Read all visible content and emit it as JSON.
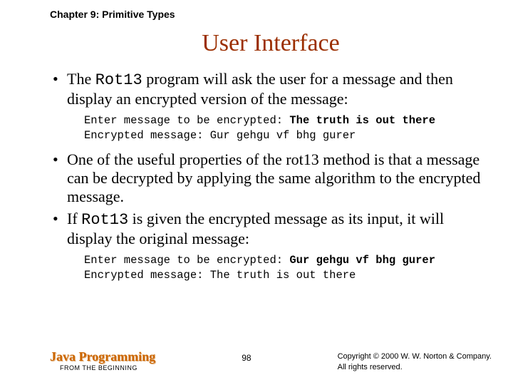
{
  "chapter": "Chapter 9: Primitive Types",
  "title": "User Interface",
  "bullets": {
    "b1_pre": "The ",
    "b1_code": "Rot13",
    "b1_post": " program will ask the user for a message and then display an encrypted version of the message:",
    "code1_line1_label": "Enter message to be encrypted: ",
    "code1_line1_input": "The truth is out there",
    "code1_line2": "Encrypted message: Gur gehgu vf bhg gurer",
    "b2": "One of the useful properties of the rot13 method is that a message can be decrypted by applying the same algorithm to the encrypted message.",
    "b3_pre": "If ",
    "b3_code": "Rot13",
    "b3_post": " is given the encrypted message as its input, it will display the original message:",
    "code2_line1_label": "Enter message to be encrypted: ",
    "code2_line1_input": "Gur gehgu vf bhg gurer",
    "code2_line2": "Encrypted message: The truth is out there"
  },
  "footer": {
    "brand": "Java Programming",
    "brand_sub": "FROM THE BEGINNING",
    "page": "98",
    "copy1": "Copyright © 2000 W. W. Norton & Company.",
    "copy2": "All rights reserved."
  }
}
